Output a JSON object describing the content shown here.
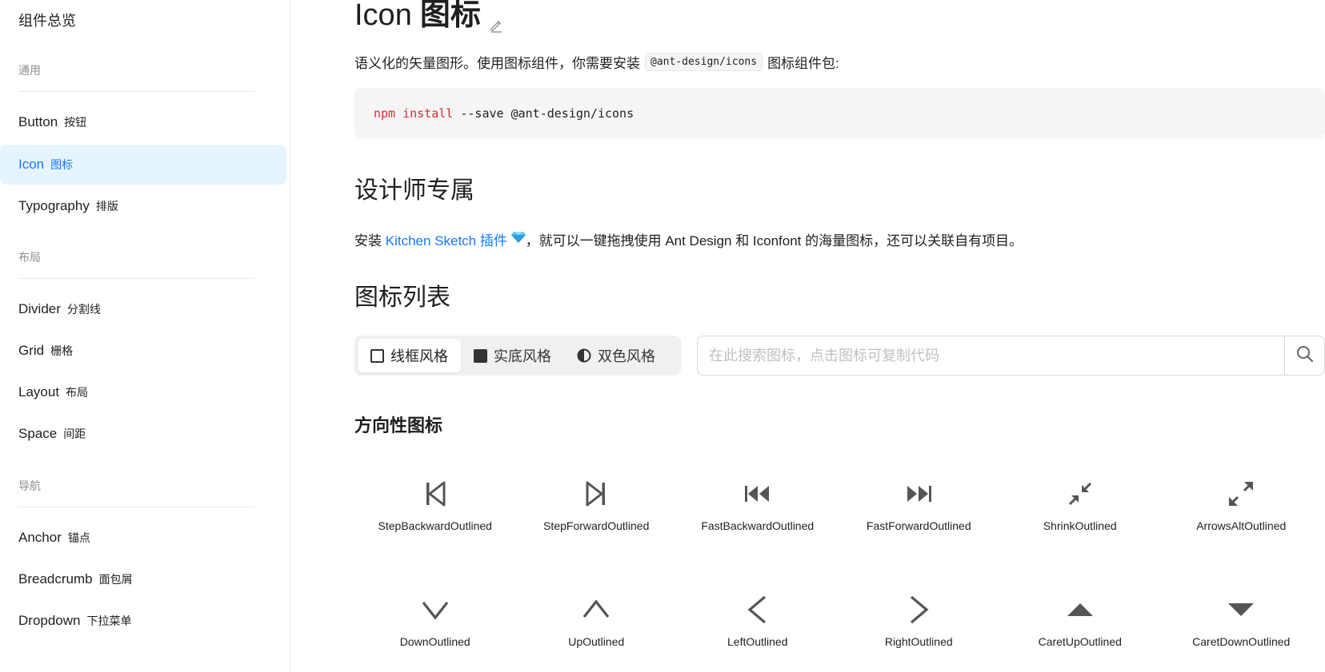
{
  "sidebar": {
    "top_item": "组件总览",
    "groups": [
      {
        "title": "通用",
        "items": [
          {
            "en": "Button",
            "zh": "按钮"
          },
          {
            "en": "Icon",
            "zh": "图标",
            "active": true
          },
          {
            "en": "Typography",
            "zh": "排版"
          }
        ]
      },
      {
        "title": "布局",
        "items": [
          {
            "en": "Divider",
            "zh": "分割线"
          },
          {
            "en": "Grid",
            "zh": "栅格"
          },
          {
            "en": "Layout",
            "zh": "布局"
          },
          {
            "en": "Space",
            "zh": "间距"
          }
        ]
      },
      {
        "title": "导航",
        "items": [
          {
            "en": "Anchor",
            "zh": "锚点"
          },
          {
            "en": "Breadcrumb",
            "zh": "面包屑"
          },
          {
            "en": "Dropdown",
            "zh": "下拉菜单"
          }
        ]
      }
    ]
  },
  "page": {
    "title_en": "Icon",
    "title_zh": "图标",
    "intro_before": "语义化的矢量图形。使用图标组件，你需要安装",
    "intro_code": "@ant-design/icons",
    "intro_after": "图标组件包:",
    "install_cmd_kw": "npm install",
    "install_cmd_rest": " --save @ant-design/icons",
    "designer_title": "设计师专属",
    "designer_before": "安装",
    "designer_link": "Kitchen Sketch 插件",
    "designer_after": "，就可以一键拖拽使用 Ant Design 和 Iconfont 的海量图标，还可以关联自有项目。",
    "list_title": "图标列表",
    "theme_options": [
      "线框风格",
      "实底风格",
      "双色风格"
    ],
    "selected_theme": "线框风格",
    "search_placeholder": "在此搜索图标，点击图标可复制代码",
    "category_title": "方向性图标"
  },
  "icons": [
    {
      "name": "StepBackwardOutlined",
      "icon": "step-backward-icon"
    },
    {
      "name": "StepForwardOutlined",
      "icon": "step-forward-icon"
    },
    {
      "name": "FastBackwardOutlined",
      "icon": "fast-backward-icon"
    },
    {
      "name": "FastForwardOutlined",
      "icon": "fast-forward-icon"
    },
    {
      "name": "ShrinkOutlined",
      "icon": "shrink-icon"
    },
    {
      "name": "ArrowsAltOutlined",
      "icon": "arrows-alt-icon"
    },
    {
      "name": "DownOutlined",
      "icon": "down-icon"
    },
    {
      "name": "UpOutlined",
      "icon": "up-icon"
    },
    {
      "name": "LeftOutlined",
      "icon": "left-icon"
    },
    {
      "name": "RightOutlined",
      "icon": "right-icon"
    },
    {
      "name": "CaretUpOutlined",
      "icon": "caret-up-icon"
    },
    {
      "name": "CaretDownOutlined",
      "icon": "caret-down-icon"
    }
  ],
  "colors": {
    "accent": "#1677ff",
    "active_bg": "#e6f4ff",
    "code_keyword": "#e3272d"
  }
}
